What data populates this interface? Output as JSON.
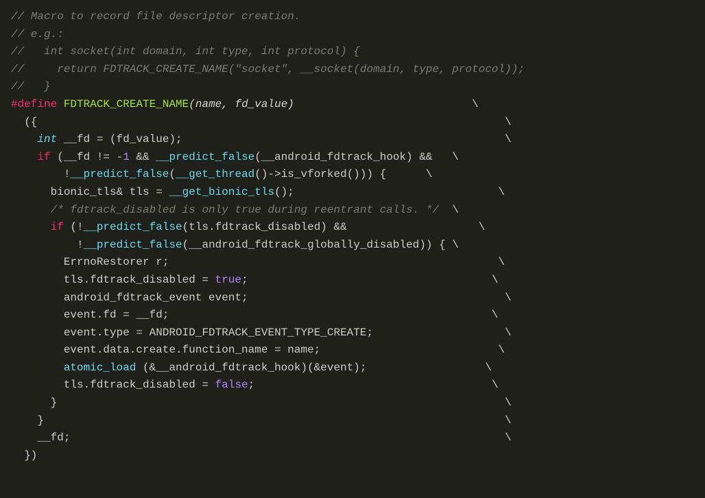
{
  "code": {
    "c1": "// Macro to record file descriptor creation.",
    "c2": "// e.g.:",
    "c3": "//   int socket(int domain, int type, int protocol) {",
    "c4": "//     return FDTRACK_CREATE_NAME(\"socket\", __socket(domain, type, protocol));",
    "c5": "//   }",
    "def": "#define",
    "macname": "FDTRACK_CREATE_NAME",
    "args": "(name, fd_value)",
    "bs": "\\",
    "l1_open": "  ({",
    "l2_type": "int",
    "l2_rest": " __fd = (fd_value);",
    "l3_if": "if",
    "l3_a": " (__fd != -",
    "l3_num": "1",
    "l3_b": " && ",
    "l3_pf": "__predict_false",
    "l3_c": "(__android_fdtrack_hook) &&",
    "l4_a": "        !",
    "l4_c": "(",
    "l4_gt": "__get_thread",
    "l4_d": "()->is_vforked())) {",
    "l5": "      bionic_tls& tls = ",
    "l5_fn": "__get_bionic_tls",
    "l5_b": "();",
    "l6": "      /* fdtrack_disabled is only true during reentrant calls. */",
    "l7_if": "if",
    "l7_a": " (!",
    "l7_c": "(tls.fdtrack_disabled) &&",
    "l8_a": "          !",
    "l8_c": "(__android_fdtrack_globally_disabled)) {",
    "l9": "        ErrnoRestorer r;",
    "l10_a": "        tls.fdtrack_disabled = ",
    "l10_true": "true",
    "l10_b": ";",
    "l11": "        android_fdtrack_event event;",
    "l12": "        event.fd = __fd;",
    "l13": "        event.type = ANDROID_FDTRACK_EVENT_TYPE_CREATE;",
    "l14": "        event.data.create.function_name = name;",
    "l15_a": "        ",
    "l15_fn": "atomic_load",
    "l15_b": " (&__android_fdtrack_hook)(&event);",
    "l16_a": "        tls.fdtrack_disabled = ",
    "l16_false": "false",
    "l16_b": ";",
    "l17": "      }",
    "l18": "    }",
    "l19": "    __fd;",
    "l20": "  })"
  }
}
